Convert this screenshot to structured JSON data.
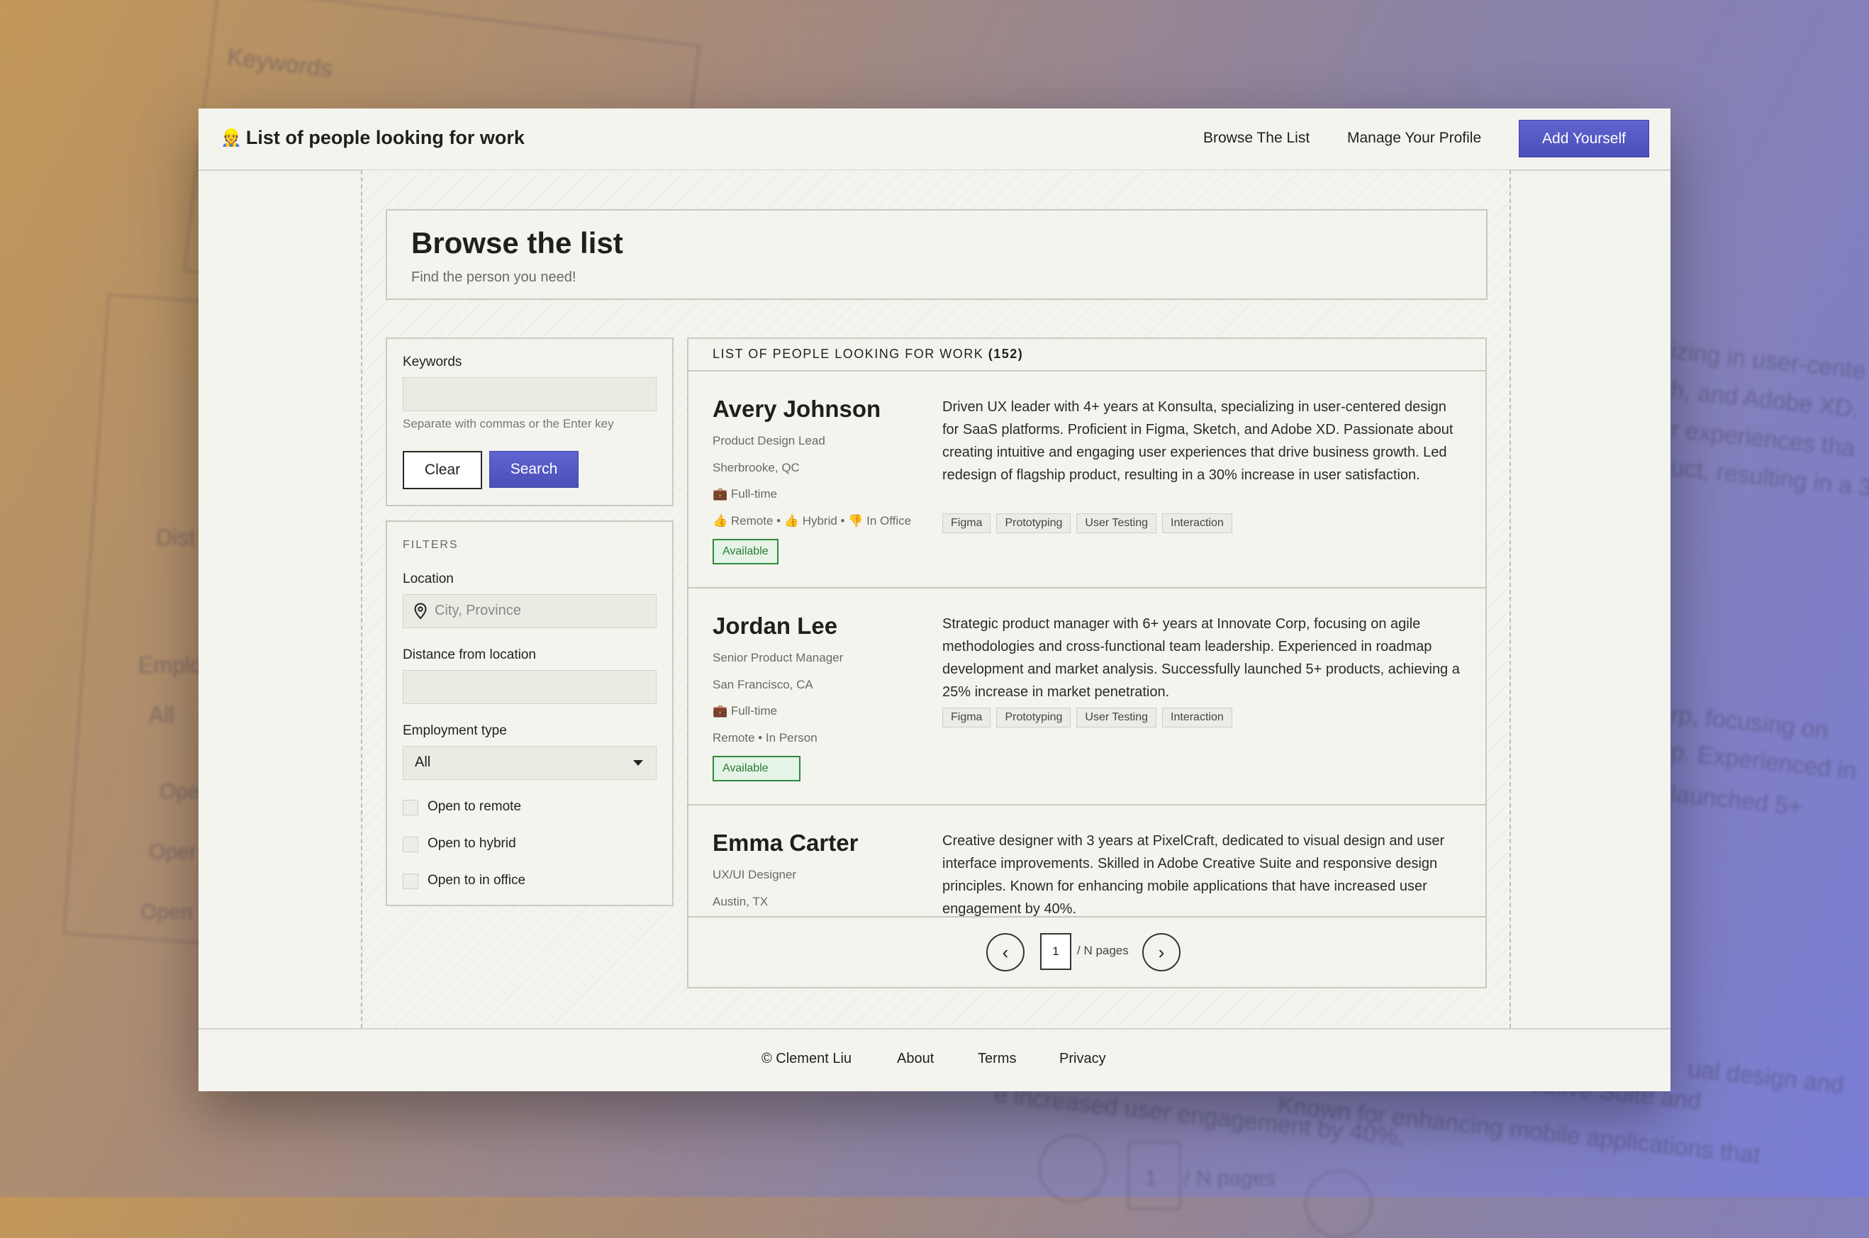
{
  "app": {
    "brand_emoji": "👷",
    "title": "List of people looking for work",
    "nav": [
      "Browse The List",
      "Manage Your Profile"
    ],
    "cta": "Add Yourself",
    "accent": "#4f53bd"
  },
  "heading": {
    "title": "Browse the list",
    "subtitle": "Find the person you need!"
  },
  "search": {
    "keywords_label": "Keywords",
    "keywords_value": "",
    "hint": "Separate with commas or the Enter key",
    "clear": "Clear",
    "search": "Search"
  },
  "filters": {
    "title": "FILTERS",
    "location_label": "Location",
    "location_placeholder": "City, Province",
    "distance_label": "Distance from location",
    "employment_label": "Employment type",
    "employment_value": "All",
    "checks": [
      "Open to remote",
      "Open to hybrid",
      "Open to in office"
    ]
  },
  "list": {
    "header": "LIST OF PEOPLE LOOKING FOR WORK",
    "count": "(152)",
    "people": [
      {
        "name": "Avery Johnson",
        "role": "Product Design Lead",
        "location": "Sherbrooke, QC",
        "type": "💼 Full-time",
        "work": "👍 Remote • 👍 Hybrid • 👎 In Office",
        "status": "Available",
        "bio": "Driven UX leader with 4+ years at Konsulta, specializing in user-centered design for SaaS platforms. Proficient in Figma, Sketch, and Adobe XD. Passionate about creating intuitive and engaging user experiences that drive business growth. Led redesign of flagship product, resulting in a 30% increase in user satisfaction.",
        "tags": [
          "Figma",
          "Prototyping",
          "User Testing",
          "Interaction"
        ]
      },
      {
        "name": "Jordan Lee",
        "role": "Senior Product Manager",
        "location": "San Francisco, CA",
        "type": "💼 Full-time",
        "work": "Remote • In Person",
        "status": "Available",
        "bio": "Strategic product manager with 6+ years at Innovate Corp, focusing on agile methodologies and cross-functional team leadership. Experienced in roadmap development and market analysis. Successfully launched 5+ products, achieving a 25% increase in market penetration.",
        "tags": [
          "Figma",
          "Prototyping",
          "User Testing",
          "Interaction"
        ]
      },
      {
        "name": "Emma Carter",
        "role": "UX/UI Designer",
        "location": "Austin, TX",
        "bio": "Creative designer with 3 years at PixelCraft, dedicated to visual design and user interface improvements. Skilled in Adobe Creative Suite and responsive design principles. Known for enhancing mobile applications that have increased user engagement by 40%."
      }
    ]
  },
  "pager": {
    "prev": "‹",
    "next": "›",
    "page": "1",
    "of": "/ N pages"
  },
  "footer": [
    "© Clement Liu",
    "About",
    "Terms",
    "Privacy"
  ],
  "background_echo": {
    "keywords": "Keywords",
    "all": "All",
    "open_1": "Ope",
    "open_2": "Oper",
    "open_3": "Open",
    "emp": "Emplo",
    "dist": "Dist",
    "r1": "izing in user-cente",
    "r2": "h, and Adobe XD.",
    "r3": "r experiences tha",
    "r4": "uct, resulting in a 3",
    "r5": "rp, focusing on",
    "r6": "p. Experienced in",
    "r7": "launched 5+",
    "b1": "ual design and",
    "b2": "Creative Suite and",
    "b3": "e increased user engagement by 40%.",
    "b4": "Known for enhancing mobile applications that",
    "b5": "1",
    "b6": "/ N pages"
  }
}
